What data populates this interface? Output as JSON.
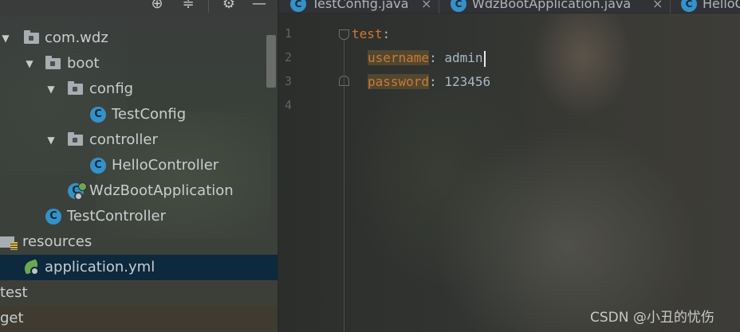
{
  "project_tree": {
    "items": [
      {
        "label": "com.wdz",
        "kind": "package",
        "expanded": true,
        "selected": false
      },
      {
        "label": "boot",
        "kind": "package",
        "expanded": true,
        "selected": false
      },
      {
        "label": "config",
        "kind": "package",
        "expanded": true,
        "selected": false
      },
      {
        "label": "TestConfig",
        "kind": "class",
        "selected": false
      },
      {
        "label": "controller",
        "kind": "package",
        "expanded": true,
        "selected": false
      },
      {
        "label": "HelloController",
        "kind": "class",
        "selected": false
      },
      {
        "label": "WdzBootApplication",
        "kind": "boot-class",
        "selected": false
      },
      {
        "label": "TestController",
        "kind": "class",
        "selected": false
      },
      {
        "label": "resources",
        "kind": "resources-folder",
        "selected": false
      },
      {
        "label": "application.yml",
        "kind": "yaml-file",
        "selected": true
      },
      {
        "label": "test",
        "kind": "folder",
        "selected": false
      },
      {
        "label": "get",
        "kind": "folder",
        "selected": false
      }
    ],
    "class_glyph": "C",
    "toolbar_icons": [
      "locate-icon",
      "collapse-all-icon",
      "settings-gear-icon",
      "hide-panel-icon"
    ]
  },
  "editor_tabs": [
    {
      "label": "TestConfig.java",
      "icon": "class-icon",
      "close": "×"
    },
    {
      "label": "WdzBootApplication.java",
      "icon": "boot-class-icon",
      "close": "×"
    },
    {
      "label": "HelloC",
      "icon": "class-icon"
    }
  ],
  "editor": {
    "line_numbers": [
      "1",
      "2",
      "3",
      "4"
    ],
    "lines": [
      {
        "key": "test",
        "colon": ":",
        "value": ""
      },
      {
        "key": "username",
        "colon": ": ",
        "value": "admin"
      },
      {
        "key": "password",
        "colon": ": ",
        "value": "123456"
      }
    ]
  },
  "watermark": "CSDN @小丑的忧伤",
  "colors": {
    "yaml_key": "#cc7832",
    "text": "#a9b7c6",
    "selection": "#0d293e",
    "class_icon": "#3591c9",
    "spring_green": "#6aa84f"
  }
}
